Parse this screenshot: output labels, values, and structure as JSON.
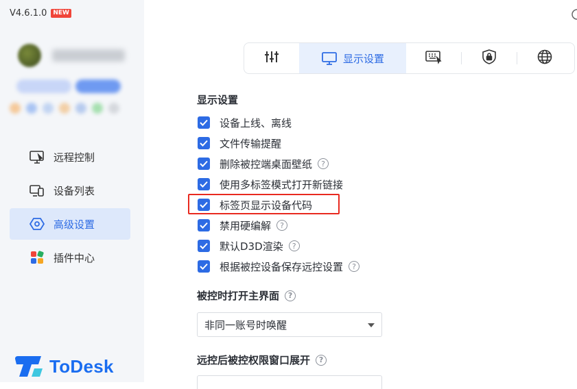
{
  "app": {
    "version": "V4.6.1.0",
    "new_badge": "NEW",
    "logo_text": "ToDesk",
    "brand_color": "#1a6df0",
    "accent_color": "#2d6be4"
  },
  "sidebar": {
    "items": [
      {
        "label": "远程控制",
        "icon": "remote-control-icon",
        "active": false
      },
      {
        "label": "设备列表",
        "icon": "device-list-icon",
        "active": false
      },
      {
        "label": "高级设置",
        "icon": "advanced-settings-icon",
        "active": true
      },
      {
        "label": "插件中心",
        "icon": "plugin-center-icon",
        "active": false
      }
    ]
  },
  "tabs": [
    {
      "label": "",
      "icon": "sliders-icon",
      "active": false
    },
    {
      "label": "显示设置",
      "icon": "monitor-icon",
      "active": true
    },
    {
      "label": "",
      "icon": "keyboard-icon",
      "active": false
    },
    {
      "label": "",
      "icon": "security-lock-icon",
      "active": false
    },
    {
      "label": "",
      "icon": "globe-icon",
      "active": false
    }
  ],
  "display_settings": {
    "title": "显示设置",
    "options": [
      {
        "label": "设备上线、离线",
        "checked": true,
        "help": false
      },
      {
        "label": "文件传输提醒",
        "checked": true,
        "help": false
      },
      {
        "label": "删除被控端桌面壁纸",
        "checked": true,
        "help": true
      },
      {
        "label": "使用多标签模式打开新链接",
        "checked": true,
        "help": false
      },
      {
        "label": "标签页显示设备代码",
        "checked": true,
        "help": false,
        "highlighted": true
      },
      {
        "label": "禁用硬编解",
        "checked": true,
        "help": true
      },
      {
        "label": "默认D3D渲染",
        "checked": true,
        "help": true
      },
      {
        "label": "根据被控设备保存远控设置",
        "checked": true,
        "help": true
      }
    ]
  },
  "open_main_ui": {
    "title": "被控时打开主界面",
    "selected": "非同一账号时唤醒"
  },
  "expand_window": {
    "title": "远控后被控权限窗口展开"
  }
}
